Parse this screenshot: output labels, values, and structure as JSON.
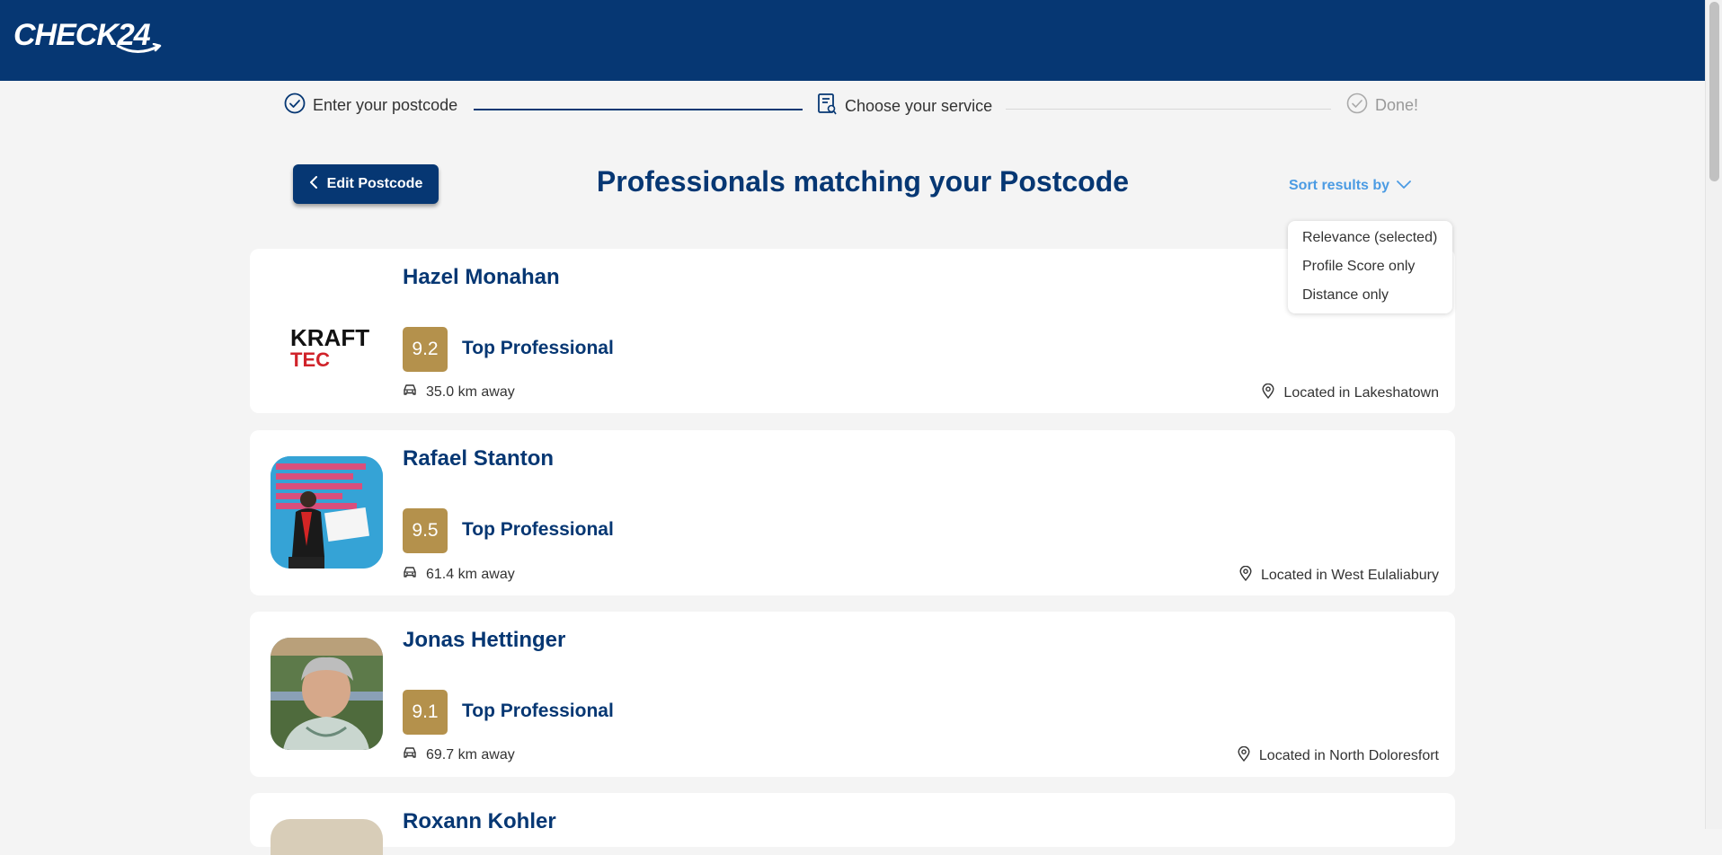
{
  "header": {
    "logo_text": "CHECK24"
  },
  "steps": [
    {
      "label": "Enter your postcode",
      "state": "done"
    },
    {
      "label": "Choose your service",
      "state": "active"
    },
    {
      "label": "Done!",
      "state": "pending"
    }
  ],
  "toolbar": {
    "edit_label": "Edit Postcode",
    "title": "Professionals matching your Postcode",
    "sort_label": "Sort results by"
  },
  "sort_menu": {
    "options": [
      "Relevance (selected)",
      "Profile Score only",
      "Distance only"
    ]
  },
  "professionals": [
    {
      "name": "Hazel Monahan",
      "score": "9.2",
      "tier": "Top Professional",
      "distance": "35.0 km away",
      "location": "Located in Lakeshatown",
      "avatar": "kraft-tec-logo"
    },
    {
      "name": "Rafael Stanton",
      "score": "9.5",
      "tier": "Top Professional",
      "distance": "61.4 km away",
      "location": "Located in West Eulaliabury",
      "avatar": "person-photo"
    },
    {
      "name": "Jonas Hettinger",
      "score": "9.1",
      "tier": "Top Professional",
      "distance": "69.7 km away",
      "location": "Located in North Doloresfort",
      "avatar": "person-photo"
    },
    {
      "name": "Roxann Kohler",
      "score": "",
      "tier": "",
      "distance": "",
      "location": "",
      "avatar": "person-photo"
    }
  ],
  "colors": {
    "brand": "#063773",
    "score_badge": "#b4914c",
    "sort_link": "#4b9be3",
    "background": "#f4f4f4"
  },
  "logo_brand_text": {
    "kraft": "KRAFT",
    "tec": "TEC"
  }
}
